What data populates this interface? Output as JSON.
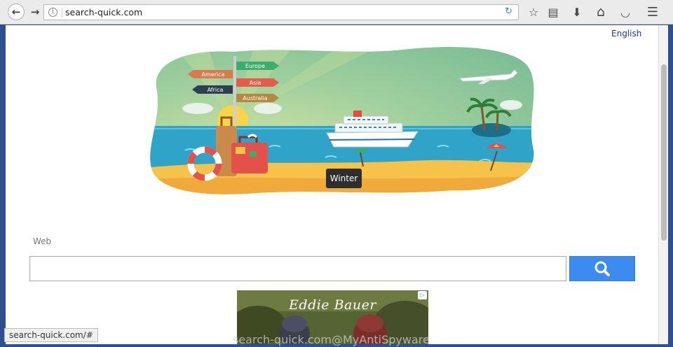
{
  "browser": {
    "url": "search-quick.com",
    "back_glyph": "←",
    "forward_glyph": "→",
    "info_glyph": "i",
    "reload_glyph": "↻",
    "icons": {
      "bookmark": "☆",
      "reader": "▤",
      "download": "⬇",
      "home": "⌂",
      "pocket": "◡",
      "menu": "☰"
    }
  },
  "page": {
    "language_link": "English",
    "hero": {
      "tooltip": "Winter",
      "signs": [
        "America",
        "Europe",
        "Asia",
        "Africa",
        "Australia"
      ]
    },
    "search": {
      "category": "Web",
      "query": "",
      "placeholder": ""
    },
    "ad": {
      "brand": "Eddie Bauer",
      "badge": "▷"
    }
  },
  "status_bar": "search-quick.com/#",
  "watermark": "search-quick.com@MyAntiSpyware",
  "colors": {
    "search_button": "#3c8bf0",
    "link": "#1a35a0",
    "sea": "#2fa4c8",
    "sand": "#f6c24a"
  }
}
